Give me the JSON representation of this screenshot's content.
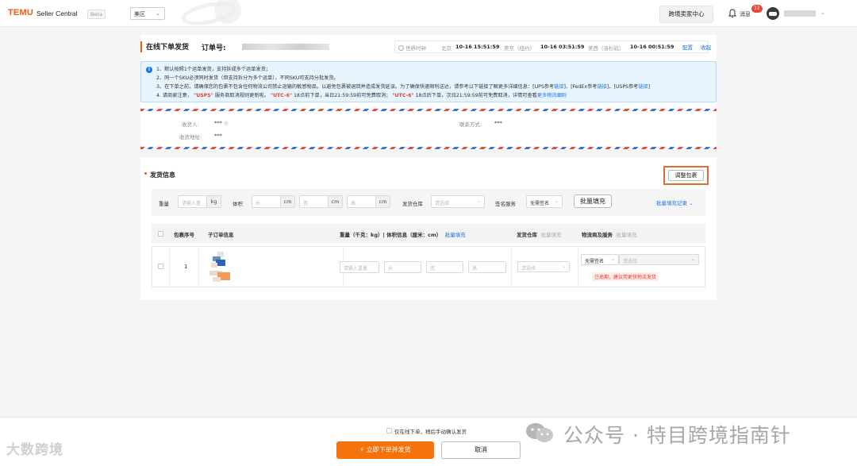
{
  "header": {
    "logo": "TEMU",
    "app_name": "Seller Central",
    "beta": "Beta",
    "region": "美区",
    "seller_center": "跨境卖家中心",
    "messages": "消息",
    "message_count": "12"
  },
  "page": {
    "title": "在线下单发货",
    "order_label": "订单号:",
    "world_time": "世界时钟",
    "times": [
      {
        "city": "北京",
        "time": "10-16 15:51:59"
      },
      {
        "city": "美东（纽约）",
        "time": "10-16 03:51:59"
      },
      {
        "city": "美西（洛杉矶）",
        "time": "10-16 00:51:59"
      }
    ],
    "config_link": "配置",
    "collapse_link": "收起"
  },
  "notice": {
    "line1": "1、默认按照1个运单发货，支持拆成多个运单发货；",
    "line2": "2、同一个SKU必须同时发货（但支持拆分为多个运单），不同SKU可支持分批发货。",
    "line3_a": "3、在下单之前，请确保您的包裹不包含任何物流公司禁止运输的敏感物品，以避免包裹被退回并造成发货延误。为了确保快速顺利送达，请参考以下链接了解更多详细信息：[UPS参考",
    "line3_link1": "链接",
    "line3_b": "]、[FedEx参考",
    "line3_link2": "链接",
    "line3_c": "]、[USPS参考",
    "line3_link3": "链接",
    "line3_d": "]",
    "line4_a": "4. 请商家注意，",
    "line4_usps": "\"USPS\"",
    "line4_b": "服务商取消规则更新啦。",
    "line4_utc1": "\"UTC-6\"",
    "line4_c": "18点前下单，当日21:59:59前可免费取消；",
    "line4_utc2": "\"UTC-6\"",
    "line4_d": "18点后下单，次日21:59:59前可免费取消，详情可查看",
    "line4_link": "更多物流细则"
  },
  "recipient": {
    "name_label": "收货人:",
    "name_value": "***",
    "contact_label": "联系方式:",
    "contact_value": "***",
    "address_label": "收货地址:",
    "address_value": "***"
  },
  "shipping": {
    "title": "发货信息",
    "adjust_button": "调整包裹",
    "filter": {
      "weight_label": "重量",
      "weight_placeholder": "请输入重",
      "weight_unit": "kg",
      "volume_label": "体积",
      "length_placeholder": "长",
      "width_placeholder": "宽",
      "height_placeholder": "高",
      "cm": "cm",
      "warehouse_label": "发货仓库",
      "select_placeholder": "请选择",
      "sign_label": "签名服务",
      "sign_value": "无需签名",
      "bulk_fill_button": "批量填充",
      "bulk_history_link": "批量填充记录"
    },
    "table": {
      "col_package_no": "包裹序号",
      "col_sub_order": "子订单信息",
      "col_weight": "重量（千克：kg）| 体积信息（厘米：cm）",
      "col_bulk_fill": "批量填充",
      "col_warehouse": "发货仓库",
      "col_warehouse_bulk": "批量填充",
      "col_logistics": "物流商及服务",
      "col_logistics_bulk": "批量填充"
    },
    "row": {
      "index": "1",
      "weight_placeholder": "请输入重量",
      "length_placeholder": "长",
      "width_placeholder": "宽",
      "height_placeholder": "高",
      "warehouse_placeholder": "请选择",
      "sign_value": "无需签名",
      "service_placeholder": "请选择",
      "warning": "已逾期，建议用更快物流发货"
    }
  },
  "footer": {
    "confirm_label": "仅在线下单，稍后手动确认发货",
    "submit_button": "立即下单并发货",
    "cancel_button": "取消"
  },
  "watermark": {
    "left": "大数跨境",
    "right": "公众号 · 特目跨境指南针"
  },
  "colors": {
    "brand": "#f05a0a",
    "primary_button": "#f5720c",
    "link": "#1a73e8",
    "warning": "#e5412d",
    "notice_bg": "#e8f4fd"
  }
}
